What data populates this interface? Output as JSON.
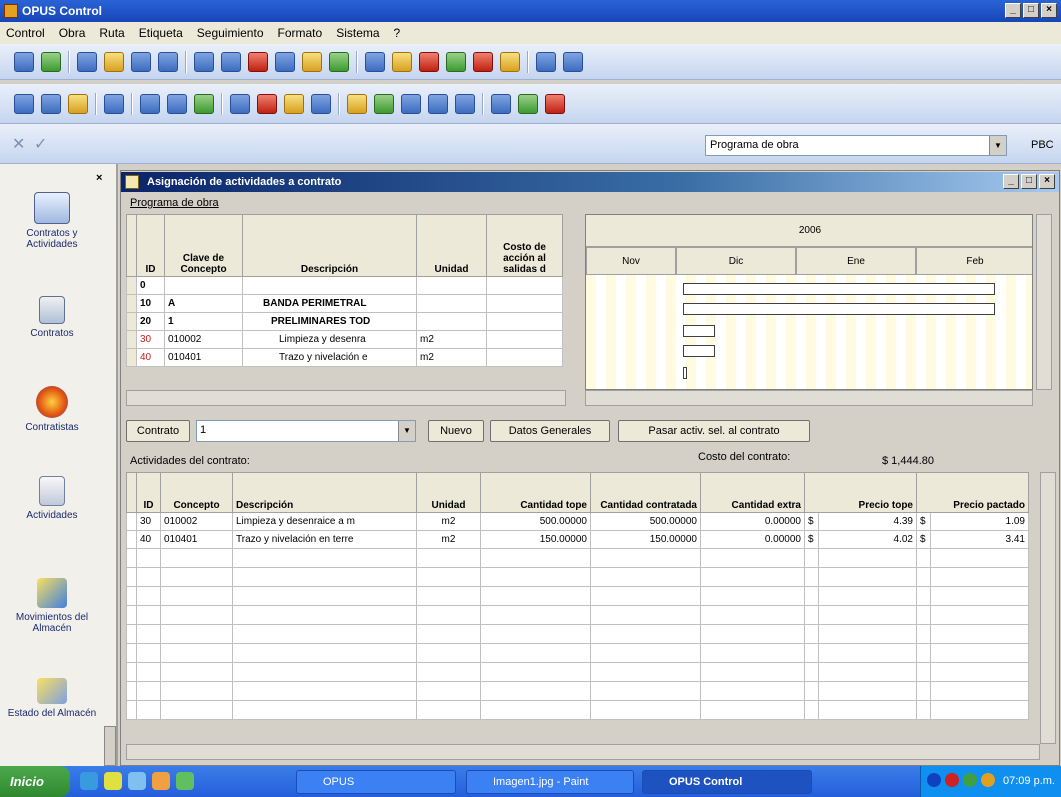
{
  "window": {
    "title": "OPUS Control"
  },
  "menu": [
    "Control",
    "Obra",
    "Ruta",
    "Etiqueta",
    "Seguimiento",
    "Formato",
    "Sistema",
    "?"
  ],
  "program_select": "Programa de obra",
  "pbc": "PBC",
  "sidebar": {
    "items": [
      "Contratos y Actividades",
      "Contratos",
      "Contratistas",
      "Actividades",
      "Movimientos del Almacén",
      "Estado del Almacén"
    ]
  },
  "child": {
    "title": "Asignación de actividades a contrato",
    "programa_label": "Programa de obra",
    "grid1": {
      "columns": [
        "ID",
        "Clave de Concepto",
        "Descripción",
        "Unidad",
        "Costo de acción al salidas d"
      ],
      "rows": [
        [
          "0",
          "",
          "",
          "",
          ""
        ],
        [
          "10",
          "A",
          "BANDA PERIMETRAL",
          "",
          ""
        ],
        [
          "20",
          "1",
          "PRELIMINARES TOD",
          "",
          ""
        ],
        [
          "30",
          "010002",
          "Limpieza y desenra",
          "m2",
          ""
        ],
        [
          "40",
          "010401",
          "Trazo y nivelación e",
          "m2",
          ""
        ]
      ]
    },
    "gantt": {
      "year": "2006",
      "months": [
        "Nov",
        "Dic",
        "Ene",
        "Feb"
      ]
    },
    "contrato_label": "Contrato",
    "contrato_value": "1",
    "buttons": {
      "nuevo": "Nuevo",
      "datos": "Datos Generales",
      "pasar": "Pasar activ. sel. al contrato"
    },
    "actividades_label": "Actividades del contrato:",
    "costo_label": "Costo del contrato:",
    "costo_value": "$ 1,444.80",
    "grid2": {
      "columns": [
        "ID",
        "Concepto",
        "Descripción",
        "Unidad",
        "Cantidad tope",
        "Cantidad contratada",
        "Cantidad extra",
        "Precio tope",
        "Precio pactado"
      ],
      "rows": [
        [
          "30",
          "010002",
          "Limpieza y desenraice a m",
          "m2",
          "500.00000",
          "500.00000",
          "0.00000",
          "$",
          "4.39",
          "$",
          "1.09"
        ],
        [
          "40",
          "010401",
          "Trazo y nivelación en terre",
          "m2",
          "150.00000",
          "150.00000",
          "0.00000",
          "$",
          "4.02",
          "$",
          "3.41"
        ]
      ]
    }
  },
  "taskbar": {
    "start": "Inicio",
    "items": [
      "OPUS",
      "Imagen1.jpg - Paint",
      "OPUS Control"
    ],
    "clock": "07:09 p.m."
  }
}
